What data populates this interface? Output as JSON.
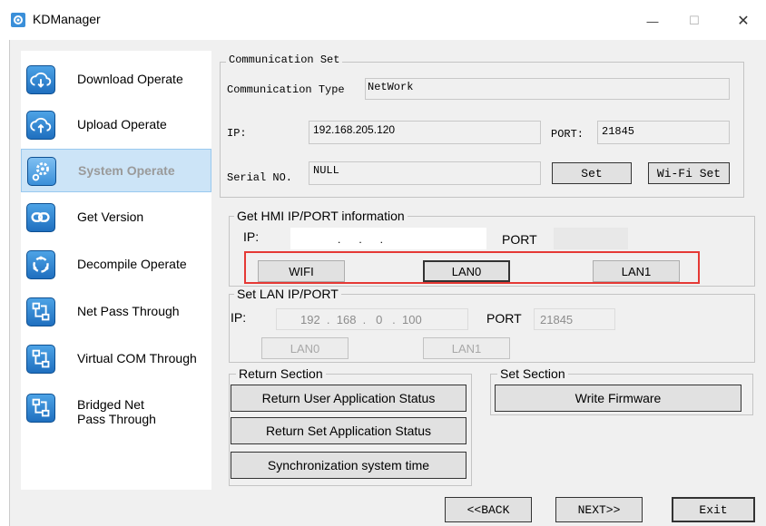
{
  "window": {
    "title": "KDManager",
    "minimize": "—",
    "maximize": "☐",
    "close": "✕"
  },
  "sidebar": {
    "items": [
      {
        "label": "Download Operate",
        "icon": "cloud-download-icon"
      },
      {
        "label": "Upload Operate",
        "icon": "cloud-upload-icon"
      },
      {
        "label": "System Operate",
        "icon": "gear-icon",
        "selected": true
      },
      {
        "label": "Get Version",
        "icon": "link-icon"
      },
      {
        "label": "Decompile Operate",
        "icon": "refresh-icon"
      },
      {
        "label": "Net Pass Through",
        "icon": "network-icon"
      },
      {
        "label": "Virtual COM Through",
        "icon": "network-icon"
      },
      {
        "label": "Bridged Net",
        "label2": "Pass Through",
        "icon": "network-icon"
      }
    ]
  },
  "communication": {
    "legend": "Communication Set",
    "type_label": "Communication Type",
    "type_value": "NetWork",
    "ip_label": "IP:",
    "ip_value": "192.168.205.120",
    "port_label": "PORT:",
    "port_value": "21845",
    "serial_label": "Serial NO.",
    "serial_value": "NULL",
    "set_button": "Set",
    "wifi_set_button": "Wi-Fi Set"
  },
  "hmi": {
    "legend": "Get HMI IP/PORT information",
    "ip_label": "IP:",
    "ip_dots": ".      .      .",
    "port_label": "PORT",
    "wifi_button": "WIFI",
    "lan0_button": "LAN0",
    "lan1_button": "LAN1"
  },
  "lan": {
    "legend": "Set LAN IP/PORT",
    "ip_label": "IP:",
    "ip_value": "192  .  168  .   0   .  100",
    "port_label": "PORT",
    "port_value": "21845",
    "lan0_button": "LAN0",
    "lan1_button": "LAN1"
  },
  "return_section": {
    "legend": "Return Section",
    "btn_user": "Return User Application Status",
    "btn_set": "Return Set Application Status",
    "btn_sync": "Synchronization system time"
  },
  "set_section": {
    "legend": "Set Section",
    "btn_firmware": "Write Firmware"
  },
  "footer": {
    "back": "<<BACK",
    "next": "NEXT>>",
    "exit": "Exit"
  },
  "colors": {
    "accent": "#1f6fbf",
    "highlight": "#e53935",
    "selected_bg": "#cce4f7"
  }
}
